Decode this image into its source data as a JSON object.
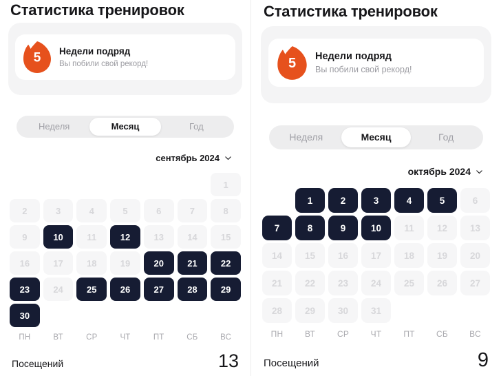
{
  "theme": {
    "accent_orange": "#E6511D",
    "cell_active_bg": "#161C33",
    "cell_inactive_bg": "#F6F6F7",
    "card_grey_bg": "#F4F4F5",
    "text_primary": "#17171A",
    "text_muted": "#9B9BA1"
  },
  "panels": [
    {
      "id": "left",
      "page_title": "Статистика тренировок",
      "streak": {
        "icon": "flame-icon",
        "count": "5",
        "title": "Недели подряд",
        "subtitle": "Вы побили свой рекорд!"
      },
      "segmented": {
        "options": [
          "Неделя",
          "Месяц",
          "Год"
        ],
        "selected": "Месяц"
      },
      "month_selector": {
        "label": "сентябрь 2024",
        "chevron": "chevron-down-icon"
      },
      "calendar": {
        "weekdays": [
          "ПН",
          "ВТ",
          "СР",
          "ЧТ",
          "ПТ",
          "СБ",
          "ВС"
        ],
        "leading_blanks": 6,
        "days": [
          {
            "n": "1",
            "active": false
          },
          {
            "n": "2",
            "active": false
          },
          {
            "n": "3",
            "active": false
          },
          {
            "n": "4",
            "active": false
          },
          {
            "n": "5",
            "active": false
          },
          {
            "n": "6",
            "active": false
          },
          {
            "n": "7",
            "active": false
          },
          {
            "n": "8",
            "active": false
          },
          {
            "n": "9",
            "active": false
          },
          {
            "n": "10",
            "active": true
          },
          {
            "n": "11",
            "active": false
          },
          {
            "n": "12",
            "active": true
          },
          {
            "n": "13",
            "active": false
          },
          {
            "n": "14",
            "active": false
          },
          {
            "n": "15",
            "active": false
          },
          {
            "n": "16",
            "active": false
          },
          {
            "n": "17",
            "active": false
          },
          {
            "n": "18",
            "active": false
          },
          {
            "n": "19",
            "active": false
          },
          {
            "n": "20",
            "active": true
          },
          {
            "n": "21",
            "active": true
          },
          {
            "n": "22",
            "active": true
          },
          {
            "n": "23",
            "active": true
          },
          {
            "n": "24",
            "active": false
          },
          {
            "n": "25",
            "active": true
          },
          {
            "n": "26",
            "active": true
          },
          {
            "n": "27",
            "active": true
          },
          {
            "n": "28",
            "active": true
          },
          {
            "n": "29",
            "active": true
          },
          {
            "n": "30",
            "active": true
          }
        ]
      },
      "footer": {
        "label": "Посещений",
        "value": "13"
      }
    },
    {
      "id": "right",
      "page_title": "Статистика тренировок",
      "streak": {
        "icon": "flame-icon",
        "count": "5",
        "title": "Недели подряд",
        "subtitle": "Вы побили свой рекорд!"
      },
      "segmented": {
        "options": [
          "Неделя",
          "Месяц",
          "Год"
        ],
        "selected": "Месяц"
      },
      "month_selector": {
        "label": "октябрь 2024",
        "chevron": "chevron-down-icon"
      },
      "calendar": {
        "weekdays": [
          "ПН",
          "ВТ",
          "СР",
          "ЧТ",
          "ПТ",
          "СБ",
          "ВС"
        ],
        "leading_blanks": 1,
        "days": [
          {
            "n": "1",
            "active": true
          },
          {
            "n": "2",
            "active": true
          },
          {
            "n": "3",
            "active": true
          },
          {
            "n": "4",
            "active": true
          },
          {
            "n": "5",
            "active": true
          },
          {
            "n": "6",
            "active": false
          },
          {
            "n": "7",
            "active": true
          },
          {
            "n": "8",
            "active": true
          },
          {
            "n": "9",
            "active": true
          },
          {
            "n": "10",
            "active": true
          },
          {
            "n": "11",
            "active": false
          },
          {
            "n": "12",
            "active": false
          },
          {
            "n": "13",
            "active": false
          },
          {
            "n": "14",
            "active": false
          },
          {
            "n": "15",
            "active": false
          },
          {
            "n": "16",
            "active": false
          },
          {
            "n": "17",
            "active": false
          },
          {
            "n": "18",
            "active": false
          },
          {
            "n": "19",
            "active": false
          },
          {
            "n": "20",
            "active": false
          },
          {
            "n": "21",
            "active": false
          },
          {
            "n": "22",
            "active": false
          },
          {
            "n": "23",
            "active": false
          },
          {
            "n": "24",
            "active": false
          },
          {
            "n": "25",
            "active": false
          },
          {
            "n": "26",
            "active": false
          },
          {
            "n": "27",
            "active": false
          },
          {
            "n": "28",
            "active": false
          },
          {
            "n": "29",
            "active": false
          },
          {
            "n": "30",
            "active": false
          },
          {
            "n": "31",
            "active": false
          }
        ]
      },
      "footer": {
        "label": "Посещений",
        "value": "9"
      }
    }
  ]
}
